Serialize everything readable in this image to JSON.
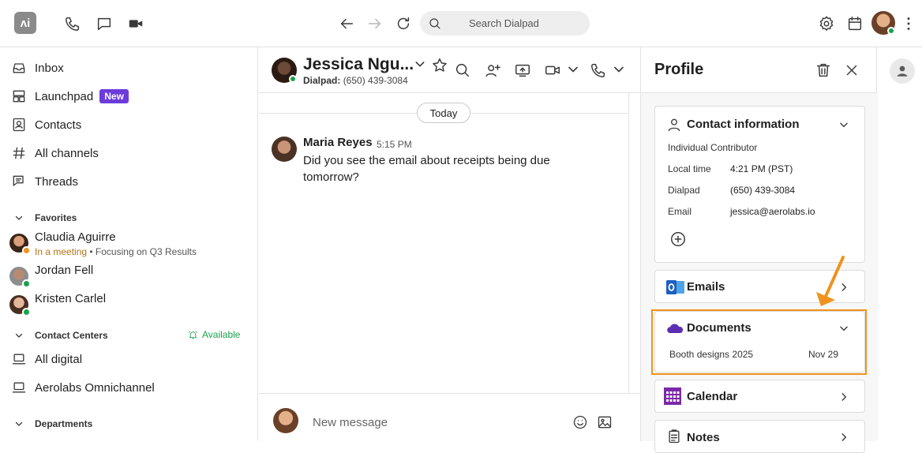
{
  "topbar": {
    "logo_text": "ʌi",
    "search_placeholder": "Search Dialpad"
  },
  "sidebar": {
    "nav": [
      {
        "label": "Inbox",
        "icon": "inbox-icon"
      },
      {
        "label": "Launchpad",
        "icon": "launchpad-icon",
        "badge": "New"
      },
      {
        "label": "Contacts",
        "icon": "contacts-icon"
      },
      {
        "label": "All channels",
        "icon": "hash-icon"
      },
      {
        "label": "Threads",
        "icon": "threads-icon"
      }
    ],
    "favorites_title": "Favorites",
    "favorites": [
      {
        "name": "Claudia Aguirre",
        "status": "In a meeting",
        "status_note": "• Focusing on Q3 Results",
        "presence": "away"
      },
      {
        "name": "Jordan Fell",
        "presence": "online"
      },
      {
        "name": "Kristen Carlel",
        "presence": "online"
      }
    ],
    "contact_centers_title": "Contact Centers",
    "availability": "Available",
    "contact_centers": [
      {
        "label": "All digital"
      },
      {
        "label": "Aerolabs Omnichannel"
      }
    ],
    "departments_title": "Departments"
  },
  "chat": {
    "contact_name": "Jessica Ngu...",
    "contact_sub_label": "Dialpad:",
    "contact_sub_number": "(650) 439-3084",
    "date_divider": "Today",
    "messages": [
      {
        "author": "Maria Reyes",
        "time": "5:15 PM",
        "text": "Did you see the email about receipts being due tomorrow?"
      }
    ],
    "composer_placeholder": "New message"
  },
  "profile": {
    "title": "Profile",
    "contact_info": {
      "title": "Contact information",
      "role": "Individual Contributor",
      "rows": [
        {
          "label": "Local time",
          "value": "4:21 PM (PST)"
        },
        {
          "label": "Dialpad",
          "value": "(650) 439-3084"
        },
        {
          "label": "Email",
          "value": "jessica@aerolabs.io"
        }
      ]
    },
    "emails_title": "Emails",
    "documents": {
      "title": "Documents",
      "items": [
        {
          "name": "Booth designs 2025",
          "date": "Nov 29"
        }
      ]
    },
    "calendar_title": "Calendar",
    "notes_title": "Notes"
  },
  "colors": {
    "accent_purple": "#6c3bdc",
    "online_green": "#1aa34a",
    "away_orange": "#f0921e",
    "highlight_orange": "#f0921e",
    "meeting_text": "#b5741a"
  }
}
